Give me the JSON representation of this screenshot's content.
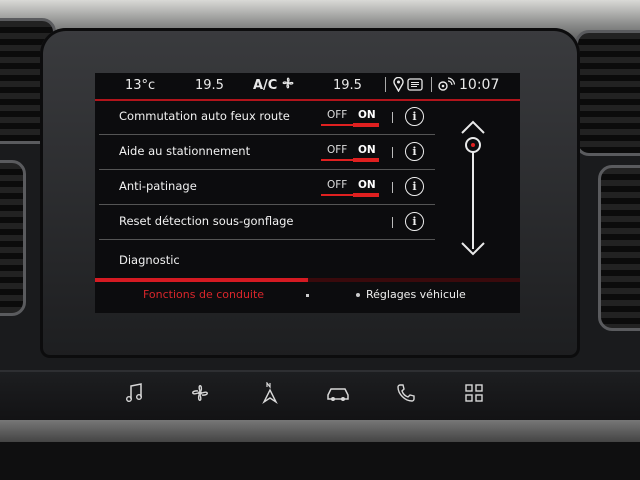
{
  "status_bar": {
    "outside_temp": "13°c",
    "left_temp": "19.5",
    "ac_label": "A/C",
    "right_temp": "19.5",
    "time": "10:07"
  },
  "settings": [
    {
      "label": "Commutation auto feux route",
      "off": "OFF",
      "on": "ON"
    },
    {
      "label": "Aide au stationnement",
      "off": "OFF",
      "on": "ON"
    },
    {
      "label": "Anti-patinage",
      "off": "OFF",
      "on": "ON"
    },
    {
      "label": "Reset détection sous-gonflage"
    }
  ],
  "diagnostic_label": "Diagnostic",
  "tabs": {
    "active": "Fonctions de conduite",
    "inactive": "Réglages véhicule",
    "progress_fraction": 0.5
  },
  "colors": {
    "accent": "#d51a22",
    "text": "#f1f1f1",
    "background": "#0c0c0e"
  },
  "hard_buttons": [
    "music-icon",
    "fan-icon",
    "navigation-icon",
    "car-icon",
    "phone-icon",
    "apps-grid-icon"
  ]
}
